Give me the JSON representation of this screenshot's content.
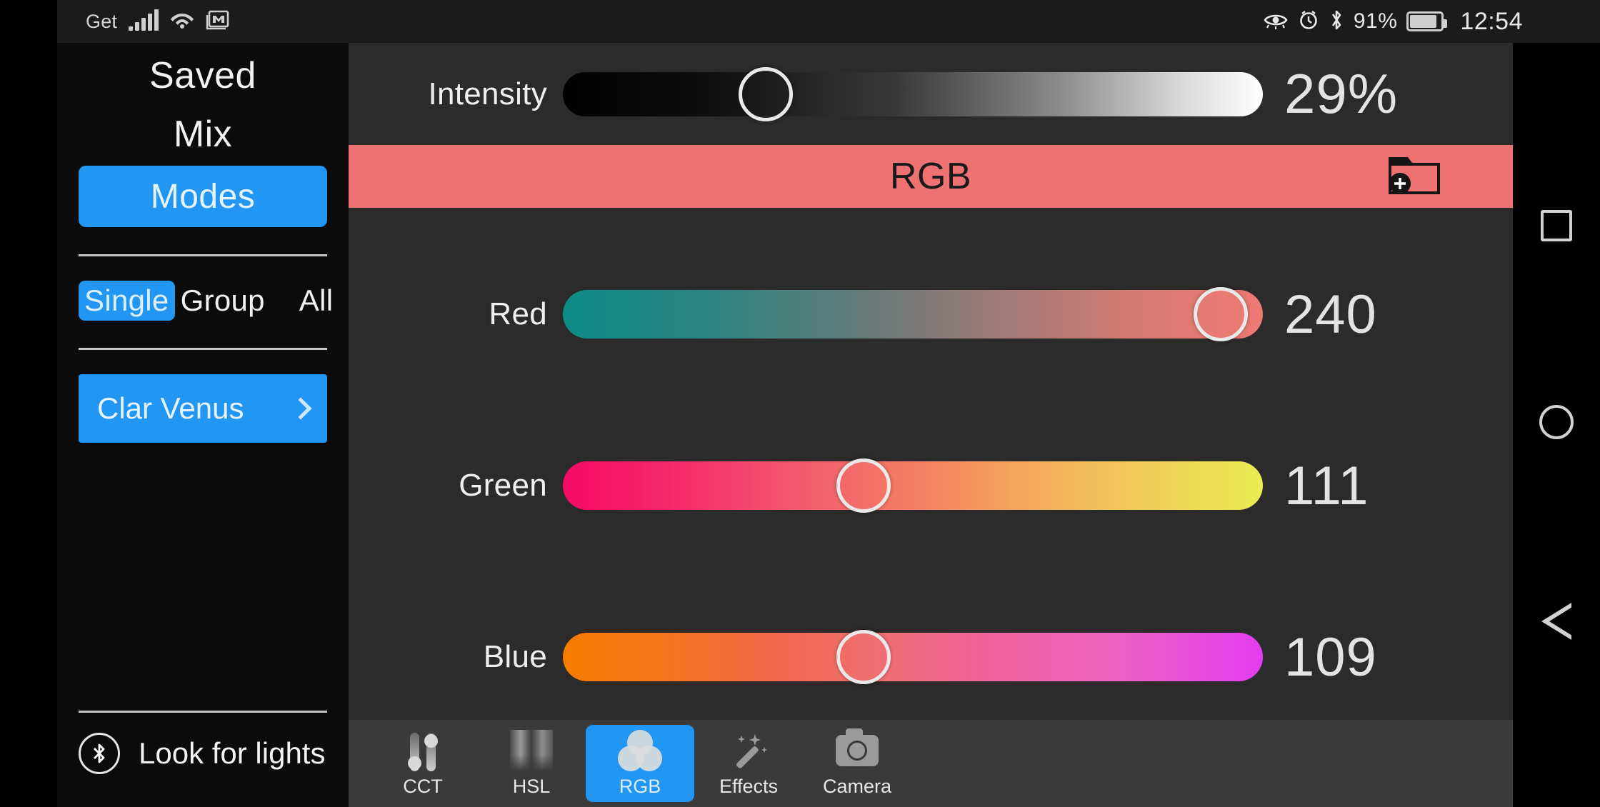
{
  "statusbar": {
    "carrier": "Get",
    "battery_pct": "91%",
    "clock": "12:54",
    "icons": [
      "signal-bars-icon",
      "wifi-icon",
      "mail-icon",
      "eye-comfort-icon",
      "alarm-icon",
      "bluetooth-icon",
      "battery-icon"
    ]
  },
  "sidebar": {
    "title_line1": "Saved",
    "title_line2": "Mix",
    "modes_label": "Modes",
    "scope": {
      "options": [
        "Single",
        "Group",
        "All"
      ],
      "selected": "Single"
    },
    "device": {
      "name": "Clar Venus",
      "chevron": "chevron-right-icon"
    },
    "look_for_lights": "Look for lights",
    "bluetooth_scan_icon": "bluetooth-scan-icon"
  },
  "main": {
    "intensity": {
      "label": "Intensity",
      "value": "29%",
      "thumb_pct": 29,
      "gradient": [
        "#000000",
        "#ffffff"
      ]
    },
    "mode_bar": {
      "title": "RGB",
      "bg_color": "#ee7272",
      "save_icon": "folder-add-icon"
    },
    "sliders": [
      {
        "label": "Red",
        "value": "240",
        "thumb_pct": 94,
        "gradient_from": "#0c8c86",
        "gradient_to": "#ef7a72"
      },
      {
        "label": "Green",
        "value": "111",
        "thumb_pct": 43,
        "gradient_from": "#f50a63",
        "gradient_to": "#e9ec52"
      },
      {
        "label": "Blue",
        "value": "109",
        "thumb_pct": 43,
        "gradient_from": "#f57c00",
        "gradient_to": "#e23df0"
      }
    ],
    "tabs": [
      {
        "label": "CCT",
        "icon": "cct-sliders-icon",
        "active": false
      },
      {
        "label": "HSL",
        "icon": "hsl-gradient-icon",
        "active": false
      },
      {
        "label": "RGB",
        "icon": "rgb-circles-icon",
        "active": true
      },
      {
        "label": "Effects",
        "icon": "magic-wand-icon",
        "active": false
      },
      {
        "label": "Camera",
        "icon": "camera-icon",
        "active": false
      }
    ]
  },
  "navbar": {
    "items": [
      {
        "name": "recents",
        "icon": "square-icon"
      },
      {
        "name": "home",
        "icon": "circle-icon"
      },
      {
        "name": "back",
        "icon": "triangle-back-icon"
      }
    ]
  },
  "theme": {
    "accent_blue": "#2196f3",
    "mode_salmon": "#ee7272",
    "panel_bg": "#2b2b2b",
    "sidebar_bg": "#0b0b0b",
    "tabbar_bg": "#3a3a3a"
  }
}
